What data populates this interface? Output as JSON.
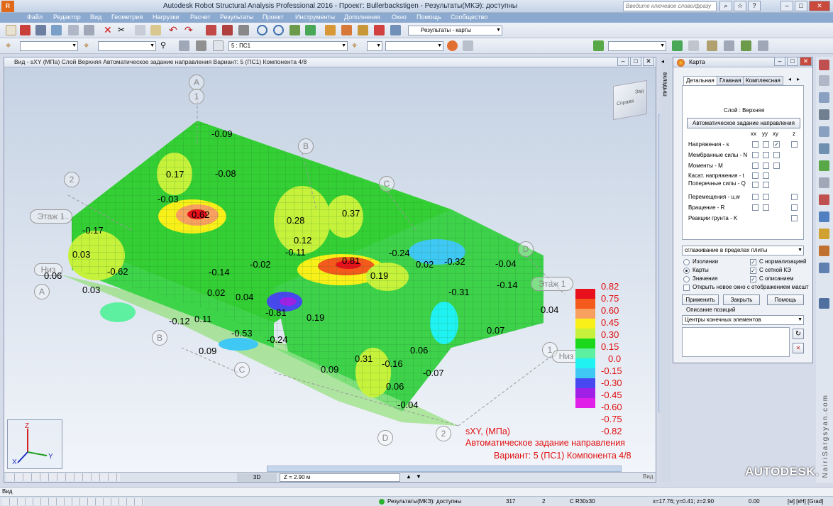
{
  "window": {
    "title": "Autodesk Robot Structural Analysis Professional 2016 - Проект: Bullerbackstigen - Результаты(МКЭ): доступны",
    "search_placeholder": "Введите ключевое слово/фразу",
    "logo": "R"
  },
  "menu": [
    "Файл",
    "Редактор",
    "Вид",
    "Геометрия",
    "Нагрузки",
    "Расчет",
    "Результаты",
    "Проект",
    "Инструменты",
    "Дополнения",
    "Окно",
    "Помощь",
    "Сообщество"
  ],
  "toolbar": {
    "layout_combo": "Результаты - карты",
    "case_combo": "5 : ПС1"
  },
  "view": {
    "title": "Вид - sXY (МПа) Слой Верхняя Автоматическое задание направления Вариант: 5 (ПС1) Компонента 4/8",
    "grid_labels": {
      "axis_a": "A",
      "axis_b": "B",
      "axis_c": "C",
      "axis_d": "D",
      "axis_1": "1",
      "axis_2": "2",
      "level1": "Этаж 1",
      "level_low": "Низ"
    },
    "values": [
      "-0.09",
      "0.62",
      "0.37",
      "0.17",
      "-0.08",
      "-0.03",
      "0.28",
      "0.81",
      "0.19",
      "-0.62",
      "0.03",
      "-0.17",
      "-0.14",
      "0.02",
      "0.04",
      "-0.81",
      "0.19",
      "-0.12",
      "0.11",
      "-0.53",
      "-0.24",
      "0.31",
      "-0.16",
      "-0.31",
      "-0.14",
      "0.04",
      "0.07",
      "0.06",
      "-0.07",
      "0.06",
      "-0.04",
      "0.09",
      "0.12",
      "-0.11",
      "-0.02",
      "-0.24",
      "0.02",
      "-0.32",
      "-0.04",
      "0.06",
      "0.03",
      "0.09"
    ],
    "legend": {
      "values": [
        "0.82",
        "0.75",
        "0.60",
        "0.45",
        "0.30",
        "0.15",
        "0.0",
        "-0.15",
        "-0.30",
        "-0.45",
        "-0.60",
        "-0.75",
        "-0.82"
      ],
      "colors": [
        "#e8101a",
        "#f45a1c",
        "#f8a060",
        "#f8f018",
        "#c6f23c",
        "#1cd81c",
        "#5cf0a0",
        "#20f2f2",
        "#40c8f4",
        "#4848f0",
        "#a020e8",
        "#e020e8"
      ]
    },
    "caption": {
      "line1": "sXY, (МПа)",
      "line2": "Автоматическое задание направления",
      "line3": "Вариант: 5 (ПС1) Компонента 4/8"
    },
    "bottom": {
      "tab_3d": "3D",
      "z_value": "Z = 2.90 м",
      "view_label": "Вид"
    },
    "cube": {
      "front": "Справа",
      "top": "Зад"
    }
  },
  "side_strip": "вкладыш",
  "carta": {
    "title": "Карта",
    "tabs": [
      "Детальная",
      "Главная",
      "Комплексная"
    ],
    "layer": "Слой : Верхняя",
    "auto_button": "Автоматическое задание направления",
    "col_headers": [
      "xx",
      "yy",
      "xy",
      "z"
    ],
    "rows": [
      "Напряжения - s",
      "Мембранные силы - N",
      "Моменты - M",
      "Касат. напряжения - t",
      "Поперечные силы - Q",
      "Перемещения - u,w",
      "Вращение - R",
      "Реакции грунта - K"
    ],
    "smoothing": "сглаживание в пределах плиты",
    "radios": [
      "Изолинии",
      "Карты",
      "Значения"
    ],
    "checks": [
      "С нормализацией",
      "С сеткой КЭ",
      "С описанием"
    ],
    "new_window": "Открыть новое окно с отображением масшт",
    "buttons": {
      "apply": "Применить",
      "close": "Закрыть",
      "help": "Помощь"
    },
    "positions_label": "Описание позиций",
    "positions_combo": "Центры конечных элементов"
  },
  "status": {
    "line1": "Вид",
    "results": "Результаты(МКЭ): доступны",
    "n1": "317",
    "n2": "2",
    "section": "С R30x30",
    "coords": "x=17.76; y=0.41; z=2.90",
    "zero": "0.00",
    "units": "[м] [кН] [Grad]"
  },
  "brand": "AUTODESK.",
  "watermark": "NairiSargsyan.com"
}
